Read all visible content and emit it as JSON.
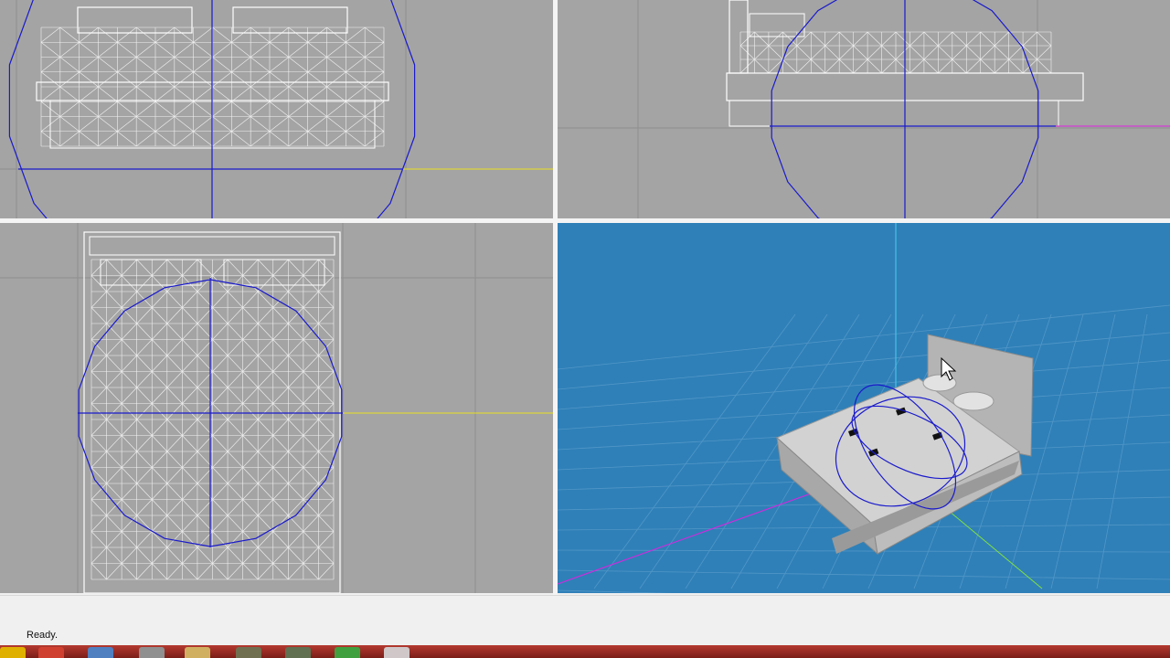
{
  "status": {
    "text": "Ready."
  },
  "viewports": [
    {
      "name": "front",
      "background": "#a4a4a4"
    },
    {
      "name": "side",
      "background": "#a4a4a4"
    },
    {
      "name": "top",
      "background": "#a4a4a4"
    },
    {
      "name": "perspective",
      "background": "#2f80b8"
    }
  ],
  "colors": {
    "wireframe": "#ffffff",
    "gizmo": "#1a1acc",
    "grid": "#8e8e8e",
    "axis_x": "#e8e020",
    "axis_y": "#e020e0",
    "axis_z": "#40d0f0",
    "mesh": "#b8b8b8"
  },
  "taskbar": {
    "items": [
      {
        "name": "start-orb-icon",
        "color": "#e0b000"
      },
      {
        "name": "chrome-icon",
        "color": "#d04030"
      },
      {
        "name": "explorer-icon",
        "color": "#5080c0"
      },
      {
        "name": "app-icon-1",
        "color": "#909090"
      },
      {
        "name": "folder-icon",
        "color": "#d0b060"
      },
      {
        "name": "app-icon-2",
        "color": "#707050"
      },
      {
        "name": "app-icon-3",
        "color": "#607050"
      },
      {
        "name": "app-icon-4",
        "color": "#40a040"
      },
      {
        "name": "active-app-icon",
        "color": "#d0c8c8"
      }
    ]
  }
}
